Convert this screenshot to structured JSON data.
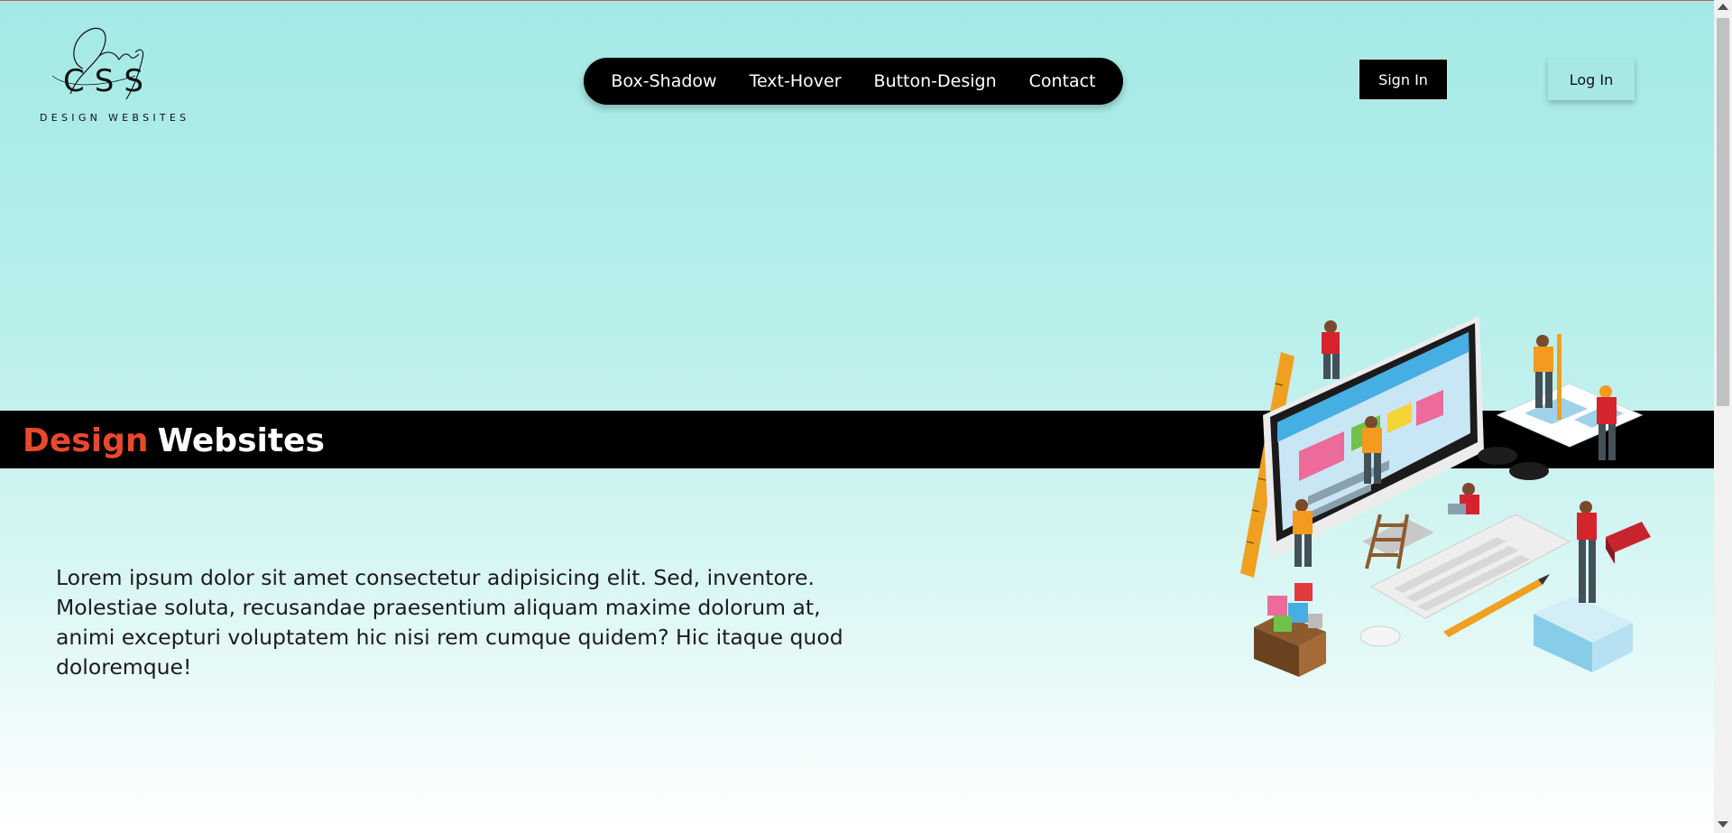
{
  "logo": {
    "script_text": "Only",
    "main_text": "CSS",
    "tagline": "DESIGN WEBSITES"
  },
  "nav": {
    "items": [
      {
        "label": "Box-Shadow"
      },
      {
        "label": "Text-Hover"
      },
      {
        "label": "Button-Design"
      },
      {
        "label": "Contact"
      }
    ]
  },
  "auth": {
    "sign_in_label": "Sign In",
    "log_in_label": "Log In"
  },
  "hero": {
    "title_accent": "Design",
    "title_main": "Websites",
    "paragraph": "Lorem ipsum dolor sit amet consectetur adipisicing elit. Sed, inventore. Molestiae soluta, recusandae praesentium aliquam maxime dolorum at, animi excepturi voluptatem hic nisi rem cumque quidem? Hic itaque quod doloremque!",
    "illustration_icon": "web-design-team-isometric-illustration"
  },
  "colors": {
    "accent": "#e8492d",
    "nav_bg": "#000000",
    "page_bg_top": "#a3e9e5",
    "login_bg": "#a8e8e4"
  }
}
